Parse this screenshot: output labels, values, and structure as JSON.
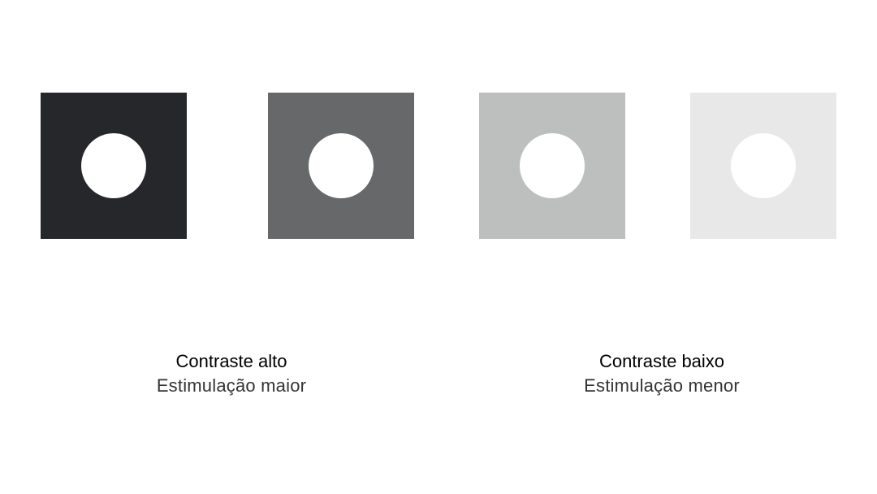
{
  "swatches": [
    {
      "fill": "#26272a",
      "dot": "#ffffff"
    },
    {
      "fill": "#676869",
      "dot": "#ffffff"
    },
    {
      "fill": "#bdbebe",
      "dot": "#ffffff"
    },
    {
      "fill": "#e8e8e8",
      "dot": "#ffffff"
    }
  ],
  "captions": {
    "high": {
      "title": "Contraste alto",
      "subtitle": "Estimulação maior"
    },
    "low": {
      "title": "Contraste baixo",
      "subtitle": "Estimulação menor"
    }
  }
}
